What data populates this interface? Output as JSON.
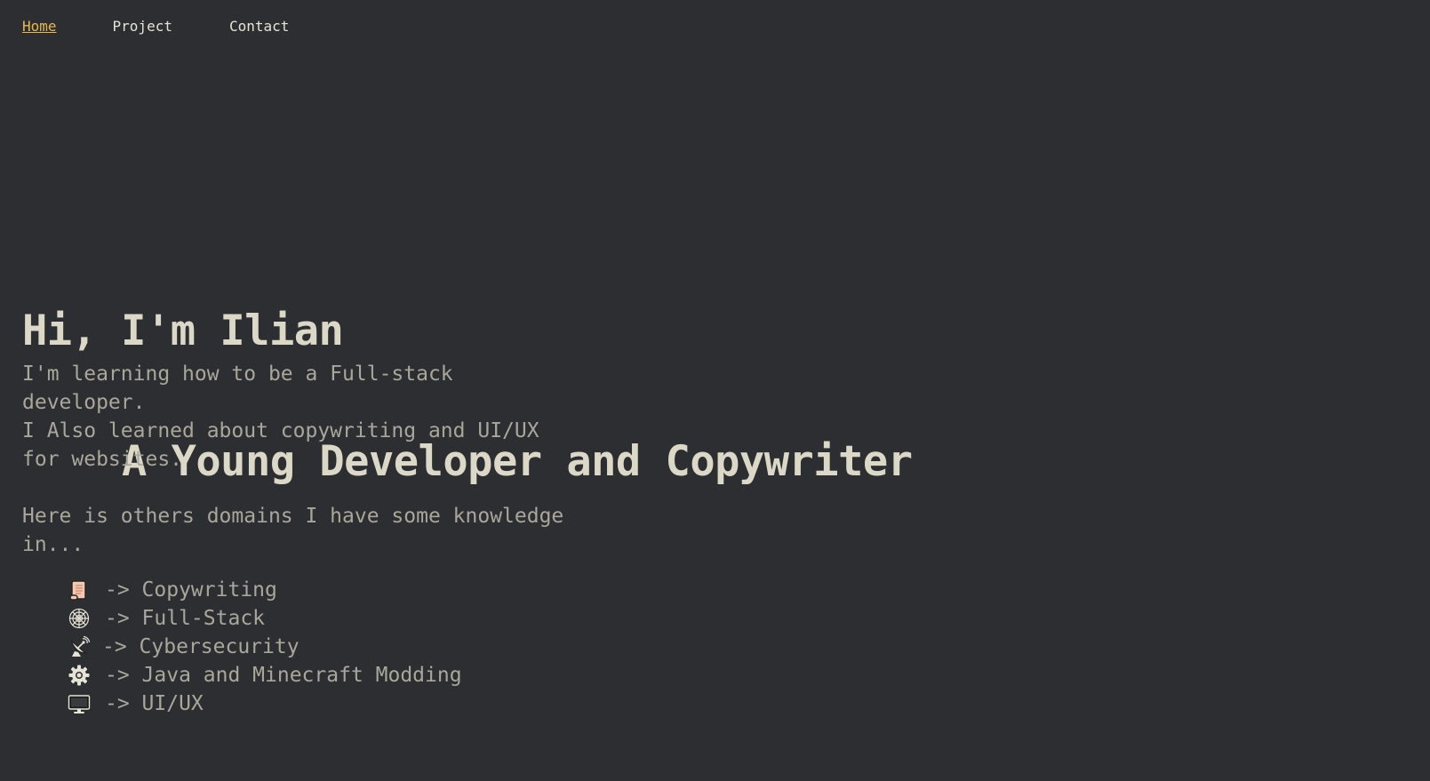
{
  "nav": {
    "items": [
      {
        "label": "Home",
        "active": true
      },
      {
        "label": "Project",
        "active": false
      },
      {
        "label": "Contact",
        "active": false
      }
    ]
  },
  "hero": {
    "line1": "Hi, I'm Ilian",
    "line2": "A Young Developer and Copywriter"
  },
  "about": {
    "intro_a": "I'm learning how to be a Full-stack developer.",
    "intro_b": "I Also learned about copywriting and UI/UX for websites.",
    "domains_intro": "Here is others domains I have some knowledge in..."
  },
  "domains": [
    {
      "icon": "scroll-icon",
      "label": "-> Copywriting"
    },
    {
      "icon": "spiderweb-icon",
      "label": "-> Full-Stack"
    },
    {
      "icon": "satellite-antenna-icon",
      "label": "-> Cybersecurity"
    },
    {
      "icon": "gear-icon",
      "label": "-> Java and Minecraft Modding"
    },
    {
      "icon": "desktop-computer-icon",
      "label": "-> UI/UX"
    }
  ],
  "colors": {
    "background": "#2d2e31",
    "accent": "#e8b84a",
    "heading": "#dcd8c8",
    "body_text": "#a9a69b"
  }
}
